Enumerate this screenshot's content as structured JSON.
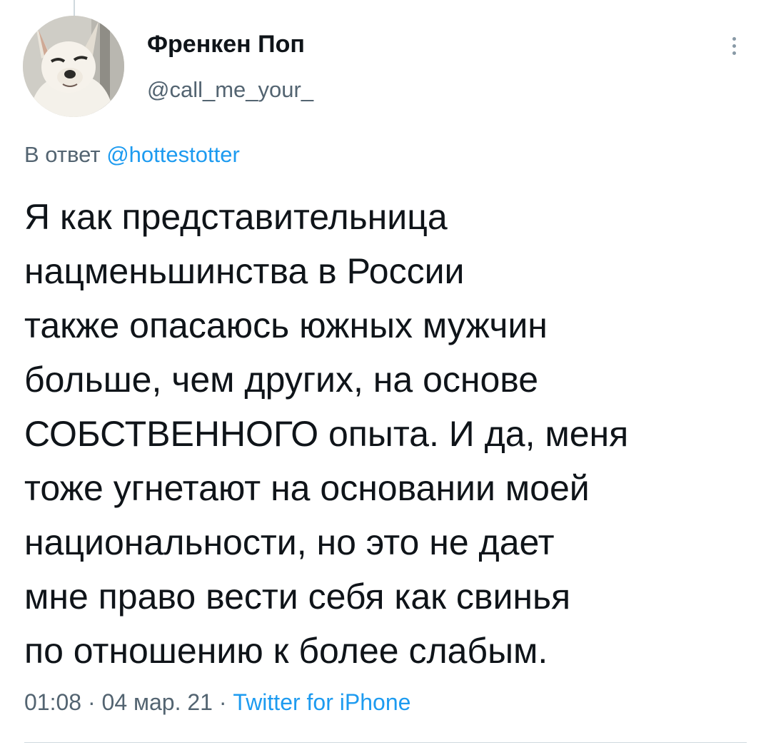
{
  "tweet": {
    "author": {
      "display_name": "Френкен Поп",
      "handle": "@call_me_your_"
    },
    "reply_to": {
      "prefix": "В ответ",
      "mention": "@hottestotter"
    },
    "text_lines": [
      "Я как представительница",
      "нацменьшинства в России",
      "также опасаюсь южных мужчин",
      "больше, чем других, на основе",
      "СОБСТВЕННОГО опыта. И да, меня",
      "тоже угнетают на основании моей",
      "национальности, но это не дает",
      "мне право вести себя как свинья",
      "по отношению к более слабым."
    ],
    "meta": {
      "time": "01:08",
      "separator": "·",
      "date": "04 мар. 21",
      "source": "Twitter for iPhone"
    }
  },
  "icons": {
    "more": "more-vertical-icon",
    "avatar": "chihuahua-avatar"
  },
  "colors": {
    "text": "#0f1419",
    "secondary": "#536471",
    "link": "#1d9bf0",
    "divider": "#cfd9de"
  }
}
